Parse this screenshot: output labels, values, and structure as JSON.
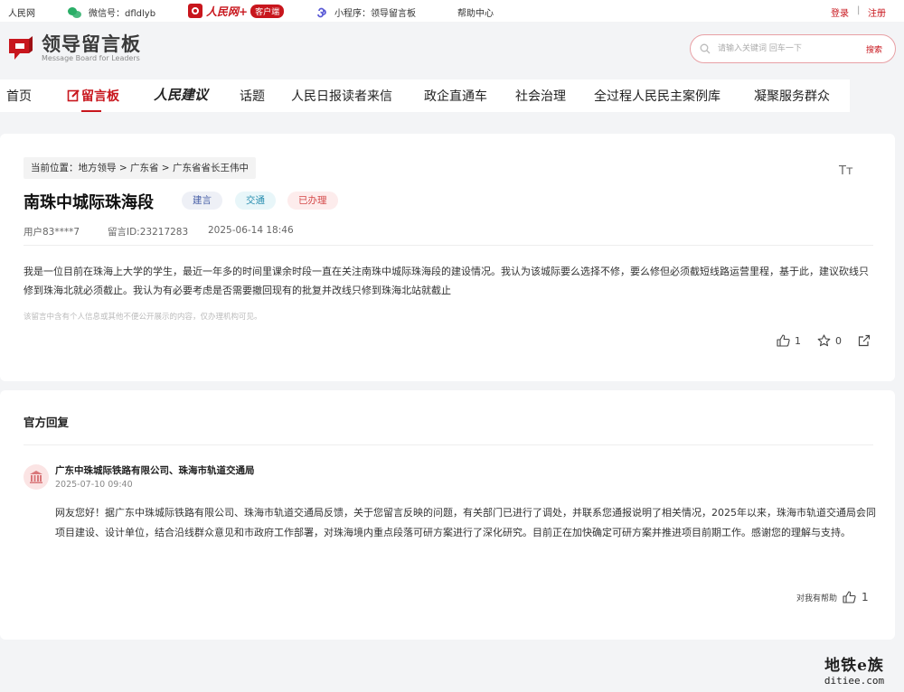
{
  "topbar": {
    "site": "人民网",
    "wechat_label": "微信号：dfldlyb",
    "app_brand": "人民网+",
    "app_badge": "客户端",
    "mini_program": "小程序：领导留言板",
    "help": "帮助中心",
    "login": "登录",
    "separator": "|",
    "register": "注册"
  },
  "header": {
    "logo_cn": "领导留言板",
    "logo_en": "Message Board for Leaders",
    "search_placeholder": "请输入关键词 回车一下",
    "search_button": "搜索"
  },
  "nav": {
    "items": [
      "首页",
      "留言板",
      "人民建议",
      "话题",
      "人民日报读者来信",
      "政企直通车",
      "社会治理",
      "全过程人民民主案例库",
      "凝聚服务群众"
    ],
    "active_index": 1
  },
  "post": {
    "breadcrumb": "当前位置：地方领导 > 广东省 > 广东省省长王伟中",
    "font_toggle": "Tт",
    "title": "南珠中城际珠海段",
    "tags": [
      "建言",
      "交通",
      "已办理"
    ],
    "user": "用户83****7",
    "message_id": "留言ID:23217283",
    "datetime": "2025-06-14 18:46",
    "content": "我是一位目前在珠海上大学的学生，最近一年多的时间里课余时段一直在关注南珠中城际珠海段的建设情况。我认为该城际要么选择不修，要么修但必须截短线路运营里程，基于此，建议砍线只修到珠海北就必须截止。我认为有必要考虑是否需要撤回现有的批复并改线只修到珠海北站就截止",
    "privacy_notice": "该留言中含有个人信息或其他不便公开展示的内容，仅办理机构可见。",
    "likes": "1",
    "favorites": "0"
  },
  "reply": {
    "heading": "官方回复",
    "org": "广东中珠城际铁路有限公司、珠海市轨道交通局",
    "date": "2025-07-10 09:40",
    "content": "网友您好！据广东中珠城际铁路有限公司、珠海市轨道交通局反馈，关于您留言反映的问题，有关部门已进行了调处，并联系您通报说明了相关情况，2025年以来，珠海市轨道交通局会同项目建设、设计单位，结合沿线群众意见和市政府工作部署，对珠海境内重点段落可研方案进行了深化研究。目前正在加快确定可研方案并推进项目前期工作。感谢您的理解与支持。",
    "helpful_label": "对我有帮助",
    "helpful_count": "1"
  },
  "watermark": {
    "line1": "地铁e族",
    "line2": "ditiee.com"
  },
  "colors": {
    "brand_red": "#c8161d",
    "wechat_green": "#2aae67",
    "miniprogram_purple": "#5b5bd6"
  }
}
